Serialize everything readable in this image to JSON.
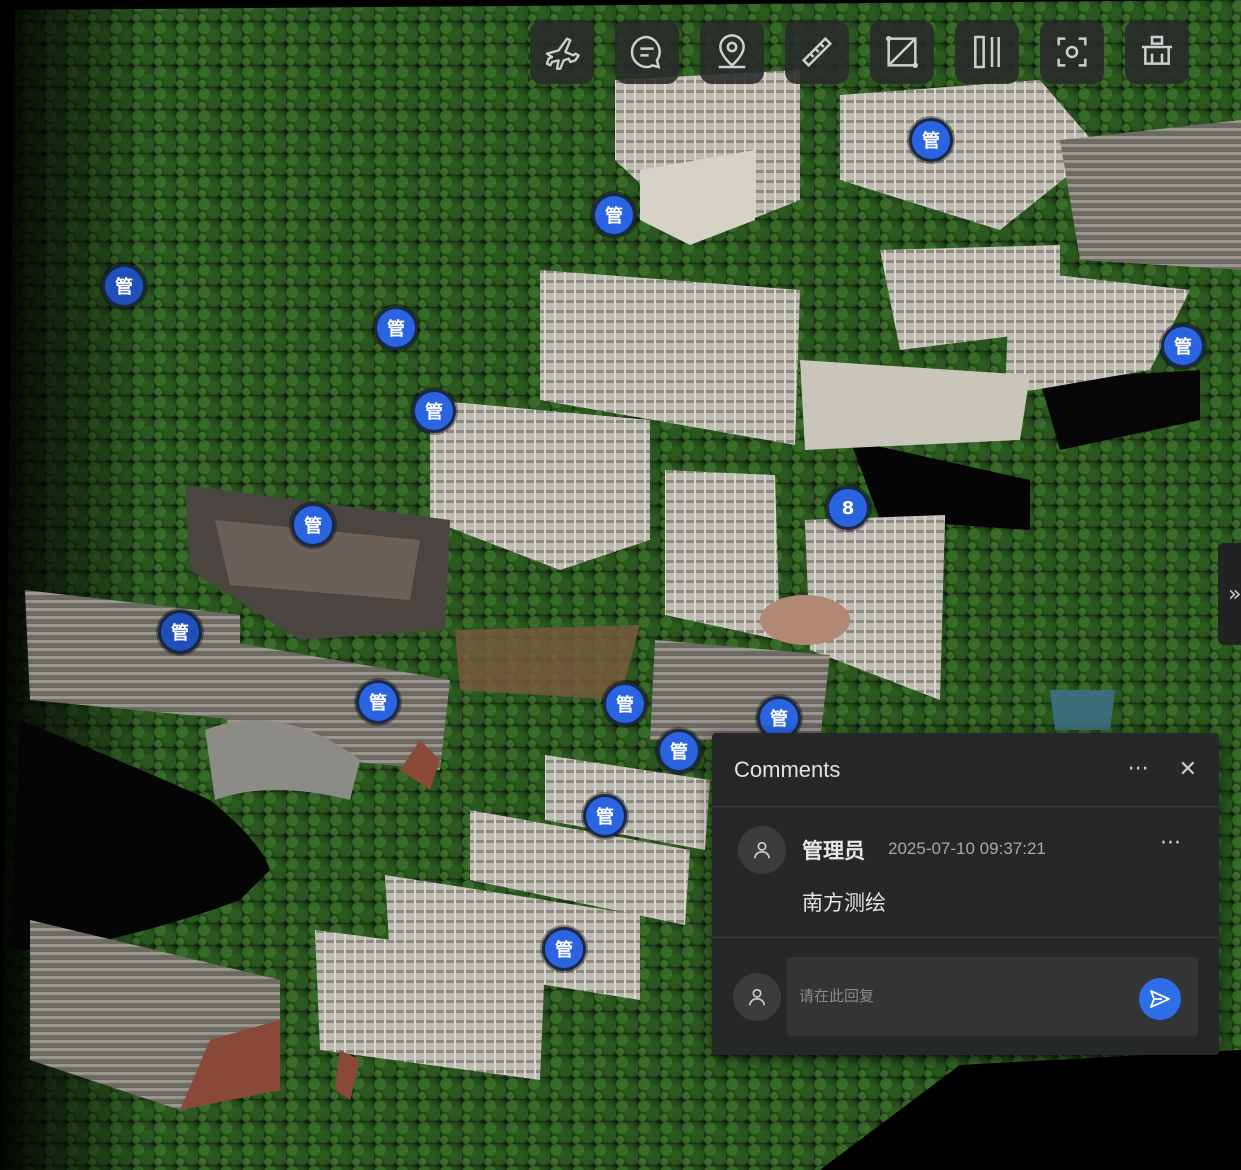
{
  "toolbar": {
    "tools": [
      {
        "icon": "flight-icon",
        "tooltip": ""
      },
      {
        "icon": "comment-icon",
        "tooltip": ""
      },
      {
        "icon": "location-pin-icon",
        "tooltip": ""
      },
      {
        "icon": "ruler-icon",
        "tooltip": ""
      },
      {
        "icon": "area-measure-icon",
        "tooltip": ""
      },
      {
        "icon": "split-view-icon",
        "tooltip": ""
      },
      {
        "icon": "screenshot-icon",
        "tooltip": ""
      },
      {
        "icon": "clip-box-icon",
        "tooltip": ""
      }
    ]
  },
  "markers": {
    "label": "管",
    "cluster_count": "8"
  },
  "side_toggle": {
    "label": "»"
  },
  "comments_panel": {
    "title": "Comments",
    "more_label": "···",
    "close_label": "✕",
    "comment": {
      "author": "管理员",
      "time": "2025-07-10 09:37:21",
      "text": "南方测绘",
      "more_label": "···"
    },
    "reply": {
      "placeholder": "请在此回复"
    }
  },
  "colors": {
    "marker": "#2b64e0",
    "panel_bg": "#262728",
    "send_button": "#2c6fe8"
  }
}
